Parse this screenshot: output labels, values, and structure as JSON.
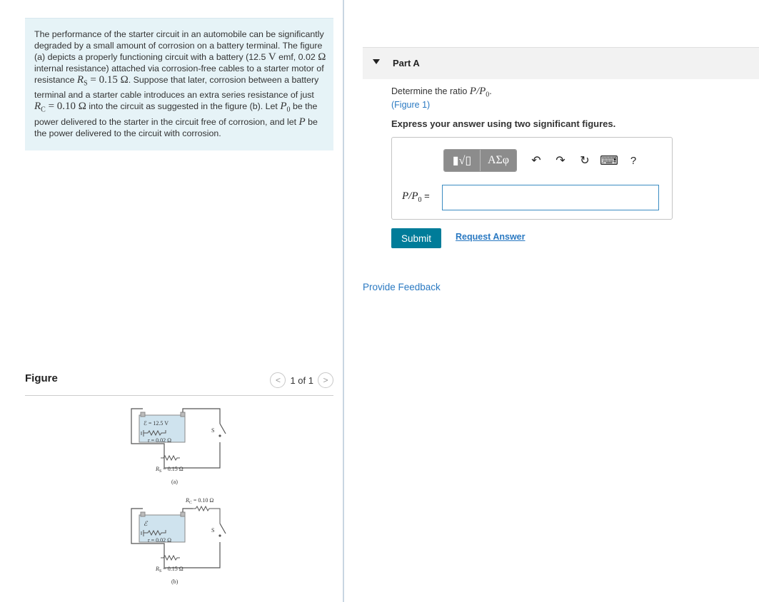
{
  "problem": {
    "t1": "The performance of the starter circuit in an automobile can be significantly degraded by a small amount of corrosion on a battery terminal. The figure (a) depicts a properly functioning circuit with a battery (12.5 ",
    "V": "V",
    "t2": " emf, 0.02 ",
    "ohm": "Ω",
    "t3": " internal resistance) attached via corrosion-free cables to a starter motor of resistance ",
    "Rs_expr": "R",
    "Rs_sub": "S",
    "Rs_val": " = 0.15 Ω",
    "t4": ". Suppose that later, corrosion between a battery terminal and a starter cable introduces an extra series resistance of just ",
    "Rc_expr": "R",
    "Rc_sub": "C",
    "Rc_val": " = 0.10 Ω",
    "t5": " into the circuit as suggested in the figure (b). Let ",
    "P0": "P",
    "P0_sub": "0",
    "t6": " be the power delivered to the starter in the circuit free of corrosion, and let ",
    "P": "P",
    "t7": " be the power delivered to the circuit with corrosion."
  },
  "figure": {
    "title": "Figure",
    "pager": "1 of 1",
    "prev": "<",
    "next": ">",
    "a": {
      "emf": "ℰ = 12.5 V",
      "r": "r = 0.02 Ω",
      "rs": "R",
      "rs_sub": "S",
      "rs_val": " = 0.15 Ω",
      "switch": "S",
      "caption": "(a)"
    },
    "b": {
      "emf": "ℰ",
      "r": "r = 0.02 Ω",
      "rc": "R",
      "rc_sub": "C",
      "rc_val": " = 0.10 Ω",
      "rs": "R",
      "rs_sub": "S",
      "rs_val": " = 0.15 Ω",
      "switch": "S",
      "caption": "(b)"
    }
  },
  "part": {
    "title": "Part A",
    "q_prefix": "Determine the ratio ",
    "q_math": "P/P",
    "q_sub": "0",
    "q_suffix": ".",
    "fig_link": "(Figure 1)",
    "instruction": "Express your answer using two significant figures.",
    "answer_label": "P/P",
    "answer_sub": "0",
    "answer_eq": " =",
    "answer_value": "",
    "toolbar": {
      "templates": "▮√▯",
      "symbols": "ΑΣφ",
      "undo": "↶",
      "redo": "↷",
      "reset": "↻",
      "keyboard": "⌨",
      "help": "?"
    },
    "submit": "Submit",
    "request": "Request Answer"
  },
  "feedback": "Provide Feedback",
  "colors": {
    "problem_bg": "#e6f3f7",
    "link": "#2a79c2",
    "submit_bg": "#007c99",
    "input_border": "#3b8cc2"
  }
}
